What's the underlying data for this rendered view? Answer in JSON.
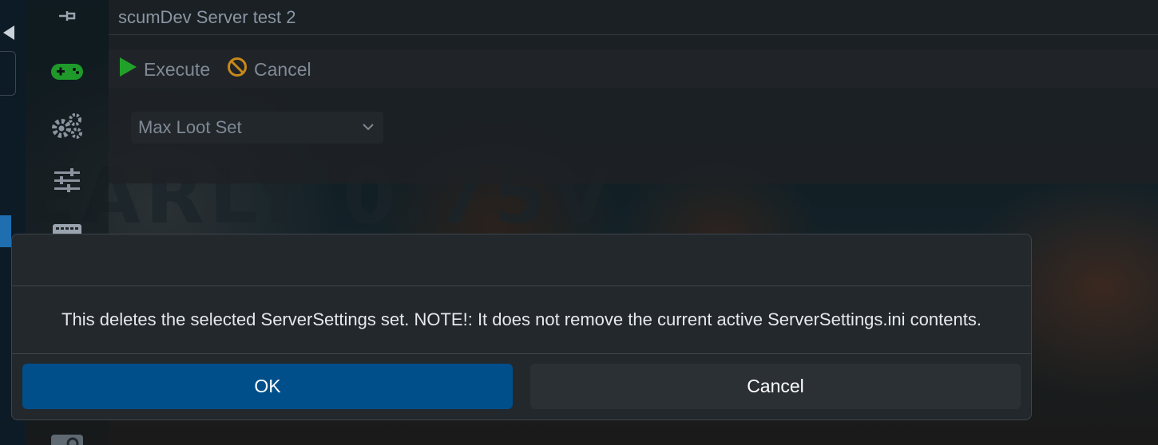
{
  "header": {
    "server_title": "scumDev Server test 2"
  },
  "toolbar": {
    "execute_label": "Execute",
    "cancel_label": "Cancel"
  },
  "settings_set": {
    "selected": "Max Loot Set"
  },
  "sidebar": {
    "icons": [
      "pin-icon",
      "gamepad-icon",
      "gears-icon",
      "sliders-icon",
      "keyboard-icon",
      "camera-icon"
    ]
  },
  "dialog": {
    "message": "This deletes the selected ServerSettings set. NOTE!: It does not remove the current active ServerSettings.ini contents.",
    "ok_label": "OK",
    "cancel_label": "Cancel"
  },
  "colors": {
    "ok_button": "#004f8a",
    "execute_icon": "#22a12a",
    "cancel_icon": "#c8891a",
    "gamepad_icon": "#1f9a2a"
  }
}
